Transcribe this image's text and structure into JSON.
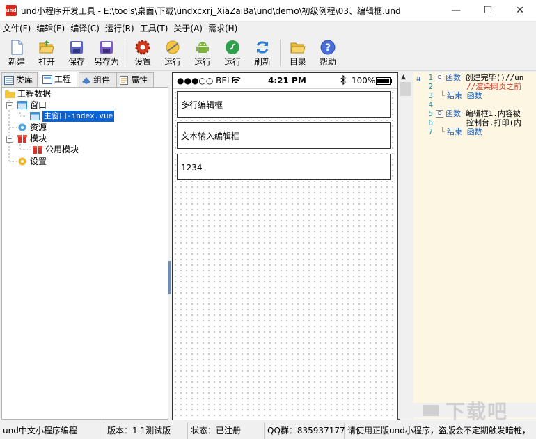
{
  "window": {
    "title": "und小程序开发工具 - E:\\tools\\桌面\\下载\\undxcxrj_XiaZaiBa\\und\\demo\\初级例程\\03、编辑框.und",
    "app_icon_text": "und",
    "minimize": "—",
    "maximize": "☐",
    "close": "✕"
  },
  "menu": [
    {
      "label": "文件(F)"
    },
    {
      "label": "编辑(E)"
    },
    {
      "label": "编译(C)"
    },
    {
      "label": "运行(R)"
    },
    {
      "label": "工具(T)"
    },
    {
      "label": "关于(A)"
    },
    {
      "label": "需求(H)"
    }
  ],
  "toolbar": [
    {
      "label": "新建",
      "icon": "new-file-icon"
    },
    {
      "label": "打开",
      "icon": "open-folder-icon"
    },
    {
      "label": "保存",
      "icon": "save-icon"
    },
    {
      "label": "另存为",
      "icon": "save-as-icon"
    },
    {
      "label": "设置",
      "icon": "gear-icon"
    },
    {
      "label": "运行",
      "icon": "run-web-icon"
    },
    {
      "label": "运行",
      "icon": "android-icon"
    },
    {
      "label": "运行",
      "icon": "wechat-run-icon"
    },
    {
      "label": "刷新",
      "icon": "refresh-icon"
    },
    {
      "label": "目录",
      "icon": "folder-icon"
    },
    {
      "label": "帮助",
      "icon": "help-icon"
    }
  ],
  "left_tabs": [
    {
      "label": "类库"
    },
    {
      "label": "工程"
    },
    {
      "label": "组件"
    },
    {
      "label": "属性"
    }
  ],
  "tree": {
    "root": "工程数据",
    "window": "窗口",
    "main_window": "主窗口-index.vue",
    "resources": "资源",
    "modules": "模块",
    "public_module": "公用模块",
    "settings": "设置"
  },
  "phone": {
    "carrier": "●●●○○ BELL",
    "time": "4:21 PM",
    "battery": "100%",
    "fields": [
      {
        "text": "多行编辑框"
      },
      {
        "text": "文本输入编辑框"
      },
      {
        "text": "1234"
      }
    ]
  },
  "code": [
    {
      "num": "1",
      "fold": "⊟",
      "kw": "函数",
      "text": " 创建完毕()//un"
    },
    {
      "num": "2",
      "fold": "",
      "kw": "",
      "comment": "//渲染网页之前"
    },
    {
      "num": "3",
      "fold": "",
      "kw": "结束 函数",
      "text": ""
    },
    {
      "num": "4",
      "fold": "",
      "kw": "",
      "text": ""
    },
    {
      "num": "5",
      "fold": "⊟",
      "kw": "函数",
      "text": " 编辑框1.内容被"
    },
    {
      "num": "6",
      "fold": "",
      "kw": "",
      "text": "控制台.打印(内"
    },
    {
      "num": "7",
      "fold": "",
      "kw": "结束 函数",
      "text": ""
    }
  ],
  "status": {
    "app": "und中文小程序编程",
    "version": "版本：1.1测试版",
    "state": "状态：已注册",
    "qq": "QQ群：835937177",
    "notice": "请使用正版und小程序，盗版会不定期触发暗桩，"
  },
  "watermark": "下载吧"
}
